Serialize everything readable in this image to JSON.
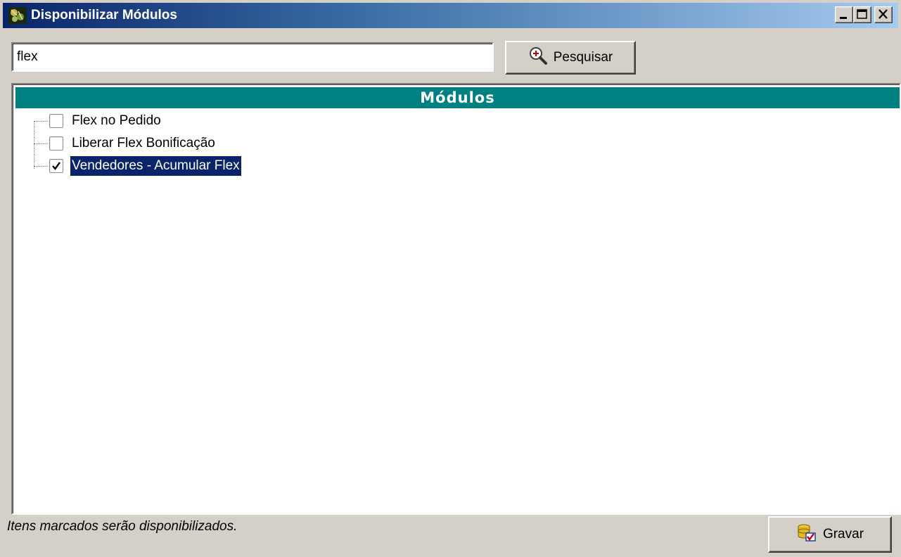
{
  "window": {
    "title": "Disponibilizar Módulos",
    "title_bar_colors": {
      "start": "#0a246a",
      "end": "#a6caf0"
    }
  },
  "search": {
    "value": "flex",
    "button_label": "Pesquisar",
    "button_icon": "magnifier-plus-icon"
  },
  "tree": {
    "header": "Módulos",
    "header_color": "#008080",
    "items": [
      {
        "label": "Flex no Pedido",
        "checked": false,
        "selected": false
      },
      {
        "label": "Liberar Flex Bonificação",
        "checked": false,
        "selected": false
      },
      {
        "label": "Vendedores - Acumular Flex",
        "checked": true,
        "selected": true
      }
    ]
  },
  "footer": {
    "note": "Itens marcados serão disponibilizados.",
    "save_label": "Gravar",
    "save_icon": "database-save-icon"
  }
}
